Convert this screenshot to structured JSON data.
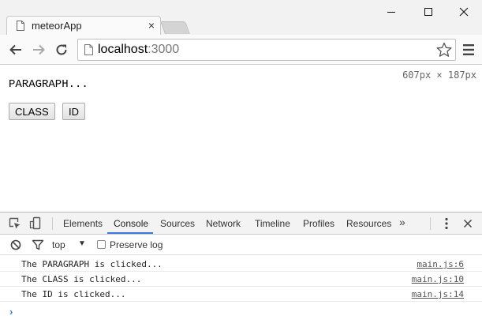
{
  "window": {
    "tab_title": "meteorApp",
    "tab_close": "×"
  },
  "toolbar": {
    "url_host": "localhost",
    "url_port": ":3000"
  },
  "page": {
    "dimensions_overlay": "607px × 187px",
    "paragraph_text": "PARAGRAPH...",
    "class_button_label": "CLASS",
    "id_button_label": "ID"
  },
  "devtools": {
    "tabs": [
      {
        "label": "Elements",
        "active": false
      },
      {
        "label": "Console",
        "active": true
      },
      {
        "label": "Sources",
        "active": false
      },
      {
        "label": "Network",
        "active": false
      },
      {
        "label": "Timeline",
        "active": false
      },
      {
        "label": "Profiles",
        "active": false
      },
      {
        "label": "Resources",
        "active": false
      }
    ],
    "more_tabs": "»",
    "filter": {
      "context": "top",
      "caret": "▼",
      "preserve_log_label": "Preserve log",
      "preserve_log_checked": false
    },
    "console_messages": [
      {
        "text": "The PARAGRAPH is clicked...",
        "source": "main.js:6"
      },
      {
        "text": "The CLASS is clicked...",
        "source": "main.js:10"
      },
      {
        "text": "The ID is clicked...",
        "source": "main.js:14"
      }
    ],
    "prompt_symbol": "›"
  },
  "colors": {
    "accent": "#3879d9",
    "prompt": "#3b82d6"
  }
}
